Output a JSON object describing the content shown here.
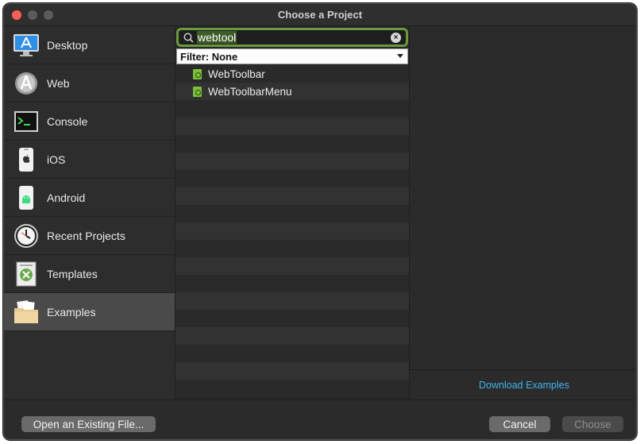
{
  "window": {
    "title": "Choose a Project"
  },
  "sidebar": {
    "items": [
      {
        "label": "Desktop",
        "icon": "desktop-app-icon",
        "selected": false
      },
      {
        "label": "Web",
        "icon": "web-app-icon",
        "selected": false
      },
      {
        "label": "Console",
        "icon": "console-terminal-icon",
        "selected": false
      },
      {
        "label": "iOS",
        "icon": "ios-phone-icon",
        "selected": false
      },
      {
        "label": "Android",
        "icon": "android-phone-icon",
        "selected": false
      },
      {
        "label": "Recent Projects",
        "icon": "clock-icon",
        "selected": false
      },
      {
        "label": "Templates",
        "icon": "template-document-icon",
        "selected": false
      },
      {
        "label": "Examples",
        "icon": "examples-folder-icon",
        "selected": true
      }
    ]
  },
  "search": {
    "value": "webtool"
  },
  "filter": {
    "label": "Filter: None"
  },
  "results": [
    {
      "name": "WebToolbar",
      "icon": "project-file-icon"
    },
    {
      "name": "WebToolbarMenu",
      "icon": "project-file-icon"
    }
  ],
  "right_panel": {
    "download_link": "Download Examples"
  },
  "footer": {
    "open_existing": "Open an Existing File...",
    "cancel": "Cancel",
    "choose": "Choose"
  },
  "colors": {
    "accent_search_border": "#6a9a3e",
    "link": "#3fb3f0",
    "selected_row": "#4a4a4a"
  }
}
